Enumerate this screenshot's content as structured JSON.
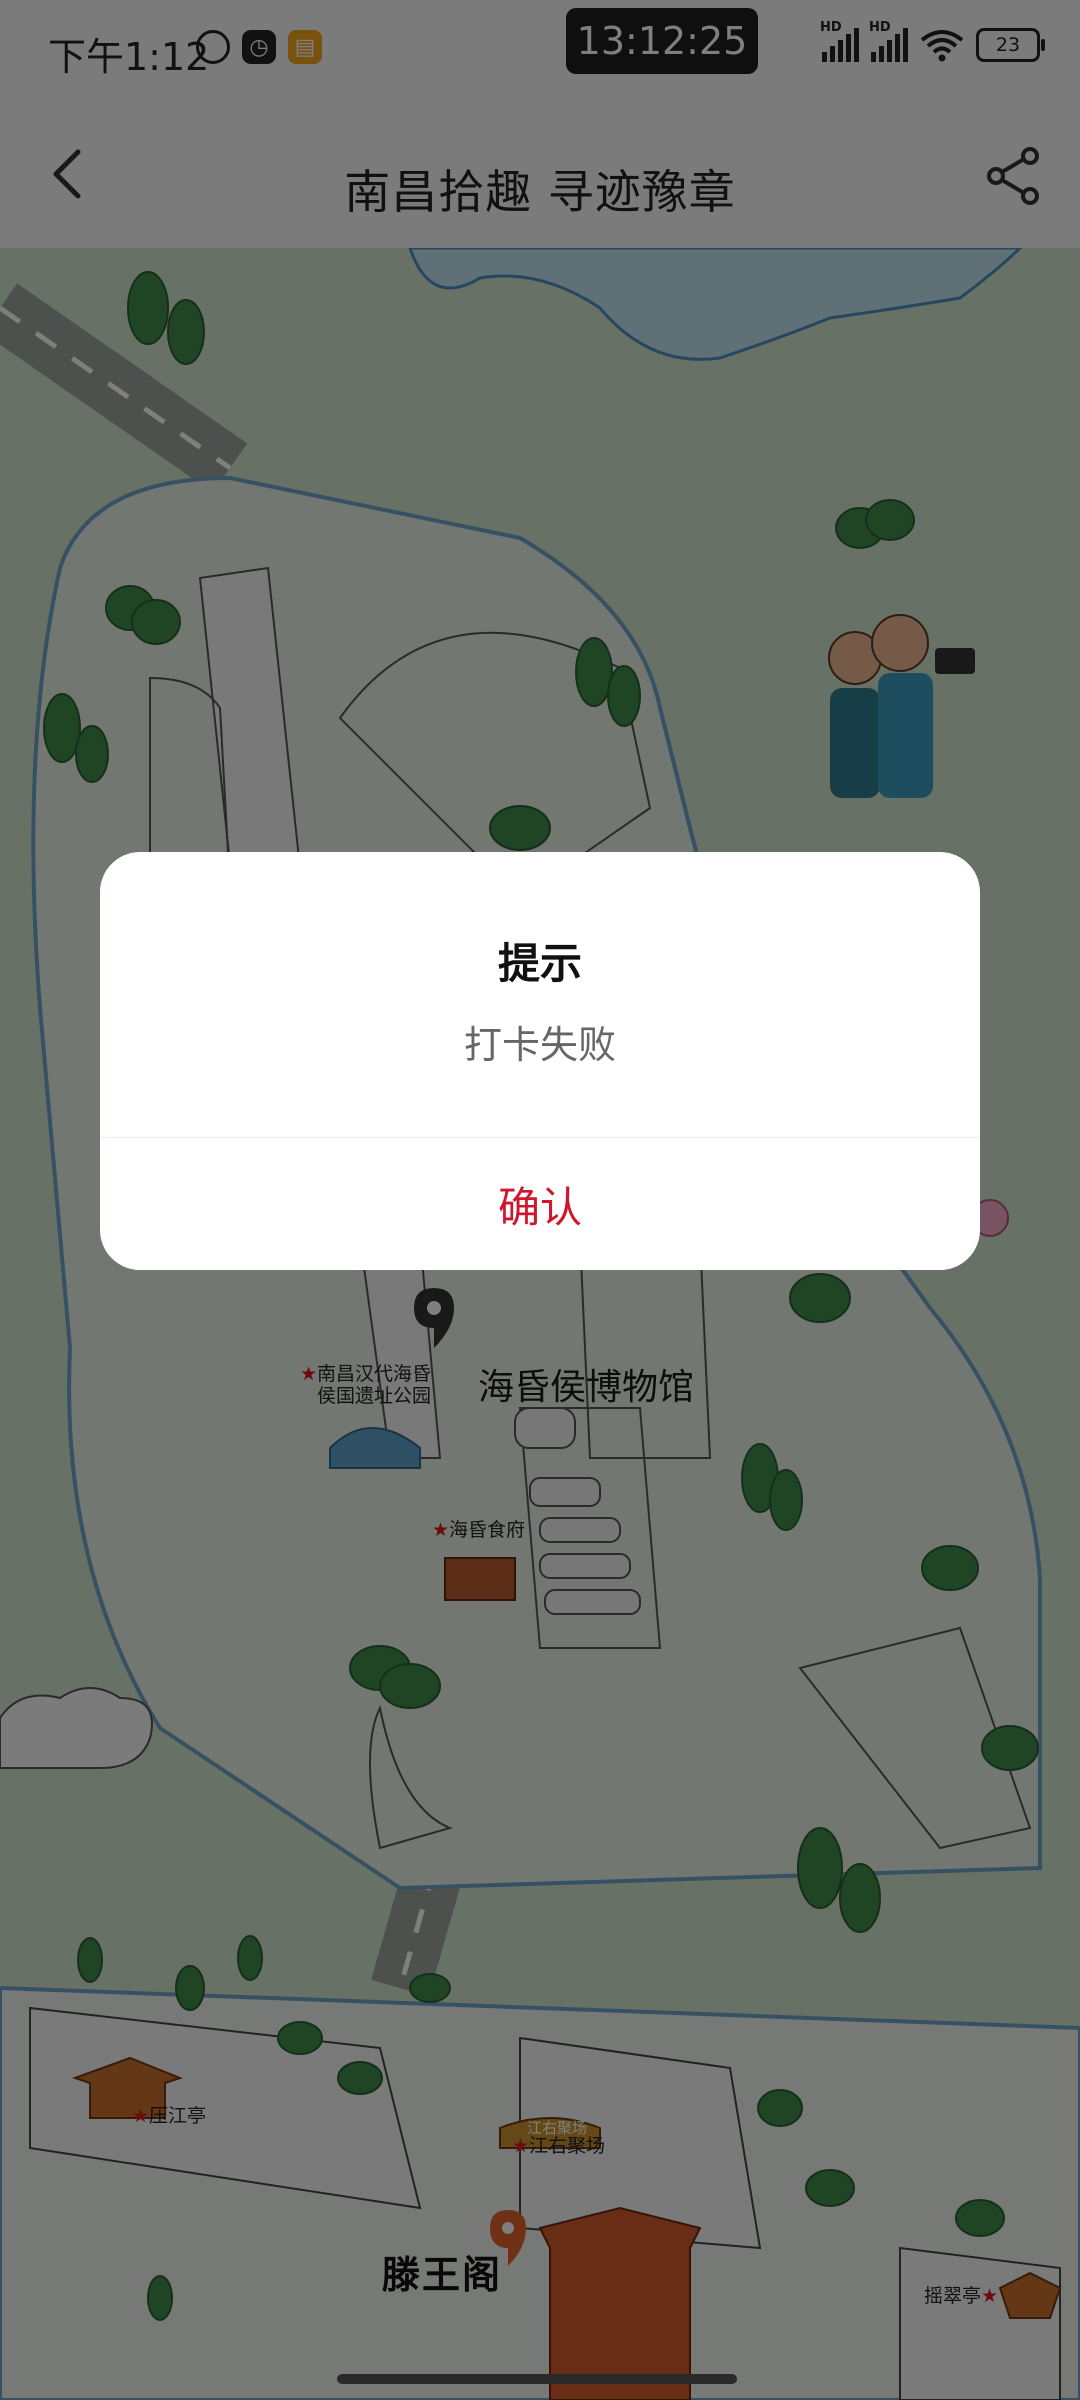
{
  "status_bar": {
    "time": "下午1:12",
    "center_time": "13:12:25",
    "battery": "23",
    "network_badge": "HD",
    "icons": [
      "alarm-icon",
      "clock-app-icon",
      "notes-app-icon",
      "signal-icon",
      "signal-icon",
      "wifi-icon",
      "battery-icon"
    ]
  },
  "header": {
    "title": "南昌拾趣 寻迹豫章",
    "back_icon": "chevron-left-icon",
    "share_icon": "share-icon"
  },
  "map": {
    "pois": {
      "relic_park": "南昌汉代海昏侯国遗址公园",
      "museum": "海昏侯博物馆",
      "food_hall": "海昏食府",
      "yajiang_pavilion": "压江亭",
      "jiangyou_plaza": "江右聚场",
      "jiangyou_sign": "江右聚场",
      "tengwang_pavilion": "滕王阁",
      "yaocui_pavilion": "摇翠亭"
    }
  },
  "dialog": {
    "title": "提示",
    "message": "打卡失败",
    "confirm_label": "确认"
  },
  "colors": {
    "confirm": "#d0162c",
    "map_background": "#cfe2cb",
    "overlay": "rgba(0,0,0,0.5)"
  }
}
